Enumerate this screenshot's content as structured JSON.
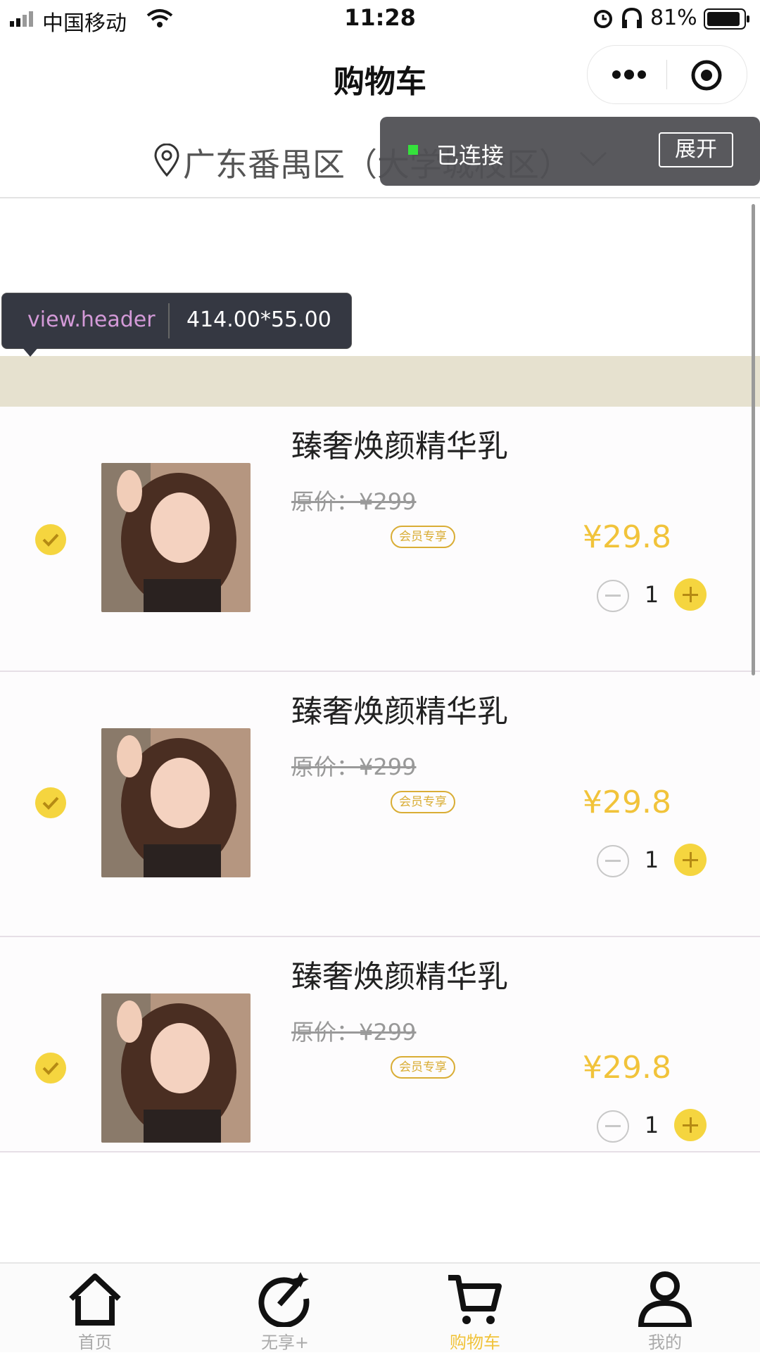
{
  "status_bar": {
    "carrier": "中国移动",
    "time": "11:28",
    "battery": "81%"
  },
  "navbar": {
    "title": "购物车"
  },
  "location": {
    "text": "广东番禺区（大学城校区）"
  },
  "debug": {
    "connection_status": "已连接",
    "expand_label": "展开",
    "inspector_selector": "view.header",
    "inspector_size": "414.00*55.00"
  },
  "cart": {
    "items": [
      {
        "name": "臻奢焕颜精华乳",
        "original_price": "原价：¥299",
        "price": "¥29.8",
        "tag": "会员专享",
        "qty": "1"
      },
      {
        "name": "臻奢焕颜精华乳",
        "original_price": "原价：¥299",
        "price": "¥29.8",
        "tag": "会员专享",
        "qty": "1"
      },
      {
        "name": "臻奢焕颜精华乳",
        "original_price": "原价：¥299",
        "price": "¥29.8",
        "tag": "会员专享",
        "qty": "1"
      }
    ]
  },
  "tabbar": {
    "items": [
      {
        "label": "首页",
        "icon": "home-icon"
      },
      {
        "label": "无享+",
        "icon": "magic-wand-icon"
      },
      {
        "label": "购物车",
        "icon": "cart-icon",
        "active": true
      },
      {
        "label": "我的",
        "icon": "user-icon"
      }
    ]
  },
  "colors": {
    "accent": "#f1c33a",
    "check": "#f5d53f",
    "inspector_margin": "#e6e1cf",
    "inspector_element": "#d86a55"
  }
}
